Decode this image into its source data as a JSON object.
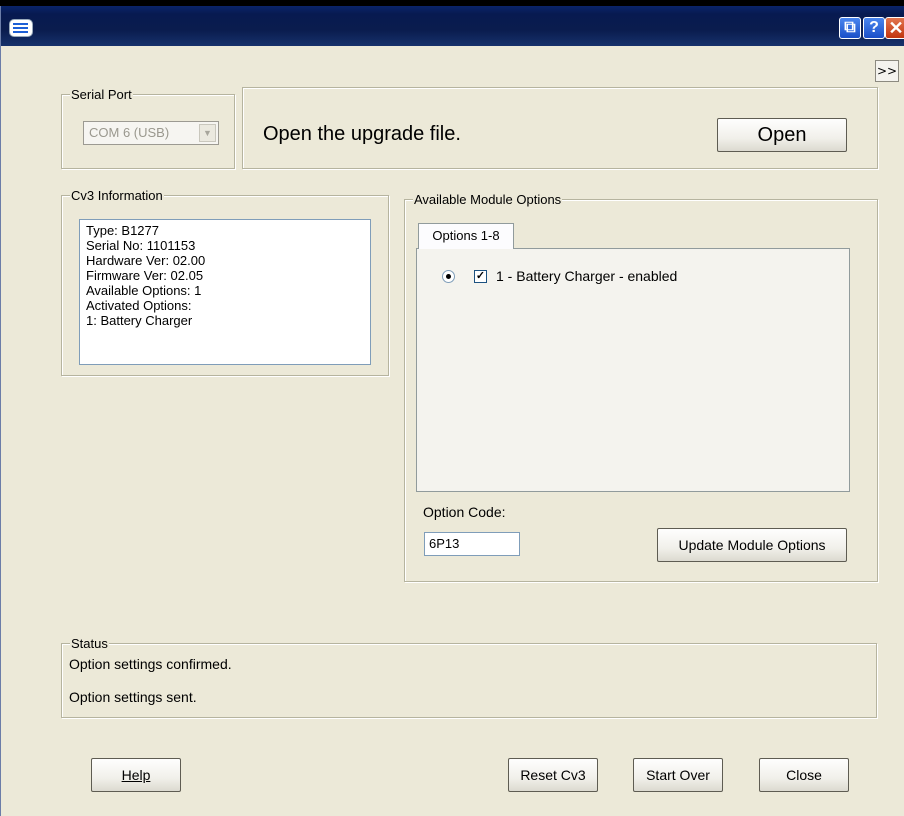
{
  "window": {
    "title_buttons": {
      "restore": "⧉",
      "help": "?",
      "close": "✕"
    }
  },
  "expand_button": ">>",
  "serial_port": {
    "legend": "Serial Port",
    "selected": "COM 6 (USB)"
  },
  "upgrade": {
    "message": "Open the upgrade file.",
    "open_label": "Open"
  },
  "cv3_info": {
    "legend": "Cv3 Information",
    "lines": [
      "Type: B1277",
      "Serial No: 1101153",
      "Hardware Ver: 02.00",
      "Firmware Ver: 02.05",
      "Available Options: 1",
      "Activated Options:",
      "1: Battery Charger"
    ]
  },
  "module_options": {
    "legend": "Available Module Options",
    "tab_label": "Options 1-8",
    "option_1": {
      "label": "1 - Battery Charger - enabled",
      "checked": true,
      "selected": true
    },
    "option_code_label": "Option Code:",
    "option_code_value": "6P13",
    "update_label": "Update Module Options"
  },
  "status": {
    "legend": "Status",
    "messages": [
      "Option settings confirmed.",
      "Option settings sent."
    ]
  },
  "footer": {
    "help_label": "Help",
    "reset_label": "Reset Cv3",
    "start_over_label": "Start Over",
    "close_label": "Close"
  }
}
